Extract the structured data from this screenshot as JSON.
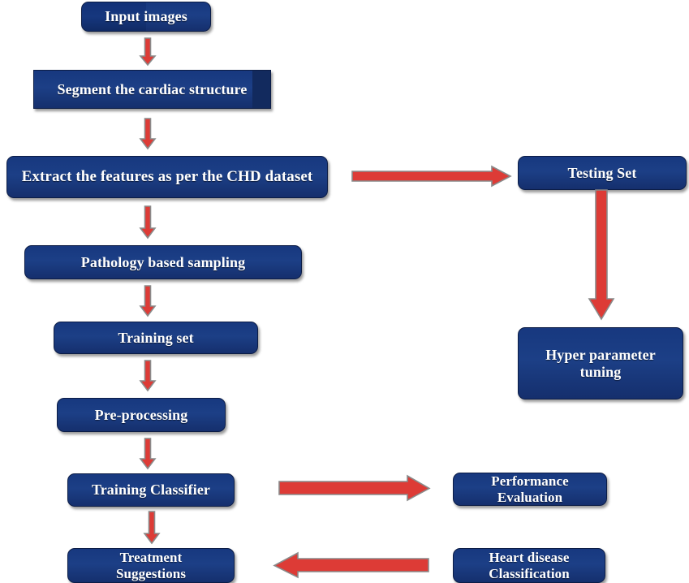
{
  "diagram": {
    "title": "Heart disease prediction workflow flowchart",
    "colors": {
      "node_fill": "#17387f",
      "node_fill_dark": "#122a5e",
      "node_border": "#0c1d46",
      "arrow_fill": "#dd3b36",
      "arrow_outline": "#8a8a8a",
      "node_text": "#ffffff",
      "background": "#ffffff"
    },
    "nodes": [
      {
        "id": "input_images",
        "label": "Input images"
      },
      {
        "id": "segment_cardiac",
        "label": "Segment the cardiac structure"
      },
      {
        "id": "extract_features",
        "label": "Extract the features as per the CHD dataset"
      },
      {
        "id": "pathology_sampling",
        "label": "Pathology based sampling"
      },
      {
        "id": "training_set",
        "label": "Training set"
      },
      {
        "id": "pre_processing",
        "label": "Pre-processing"
      },
      {
        "id": "training_classifier",
        "label": "Training Classifier"
      },
      {
        "id": "treatment",
        "label": "Treatment\nSuggestions",
        "line1": "Treatment",
        "line2": "Suggestions"
      },
      {
        "id": "testing_set",
        "label": "Testing Set"
      },
      {
        "id": "hyper_parameter",
        "label": "Hyper parameter tuning",
        "line1": "Hyper parameter",
        "line2": "tuning"
      },
      {
        "id": "performance_eval",
        "label": "Performance Evaluation",
        "line1": "Performance",
        "line2": "Evaluation"
      },
      {
        "id": "heart_disease",
        "label": "Heart disease Classification",
        "line1": "Heart disease",
        "line2": "Classification"
      }
    ],
    "edges": [
      {
        "id": "e1",
        "from": "input_images",
        "to": "segment_cardiac",
        "direction": "down"
      },
      {
        "id": "e2",
        "from": "segment_cardiac",
        "to": "extract_features",
        "direction": "down"
      },
      {
        "id": "e3",
        "from": "extract_features",
        "to": "testing_set",
        "direction": "right"
      },
      {
        "id": "e4",
        "from": "extract_features",
        "to": "pathology_sampling",
        "direction": "down"
      },
      {
        "id": "e5",
        "from": "pathology_sampling",
        "to": "training_set",
        "direction": "down"
      },
      {
        "id": "e6",
        "from": "training_set",
        "to": "pre_processing",
        "direction": "down"
      },
      {
        "id": "e7",
        "from": "pre_processing",
        "to": "training_classifier",
        "direction": "down"
      },
      {
        "id": "e8",
        "from": "training_classifier",
        "to": "performance_eval",
        "direction": "right"
      },
      {
        "id": "e9",
        "from": "training_classifier",
        "to": "treatment",
        "direction": "down"
      },
      {
        "id": "e10",
        "from": "testing_set",
        "to": "hyper_parameter",
        "direction": "down"
      },
      {
        "id": "e11",
        "from": "heart_disease",
        "to": "treatment",
        "direction": "left"
      }
    ]
  }
}
